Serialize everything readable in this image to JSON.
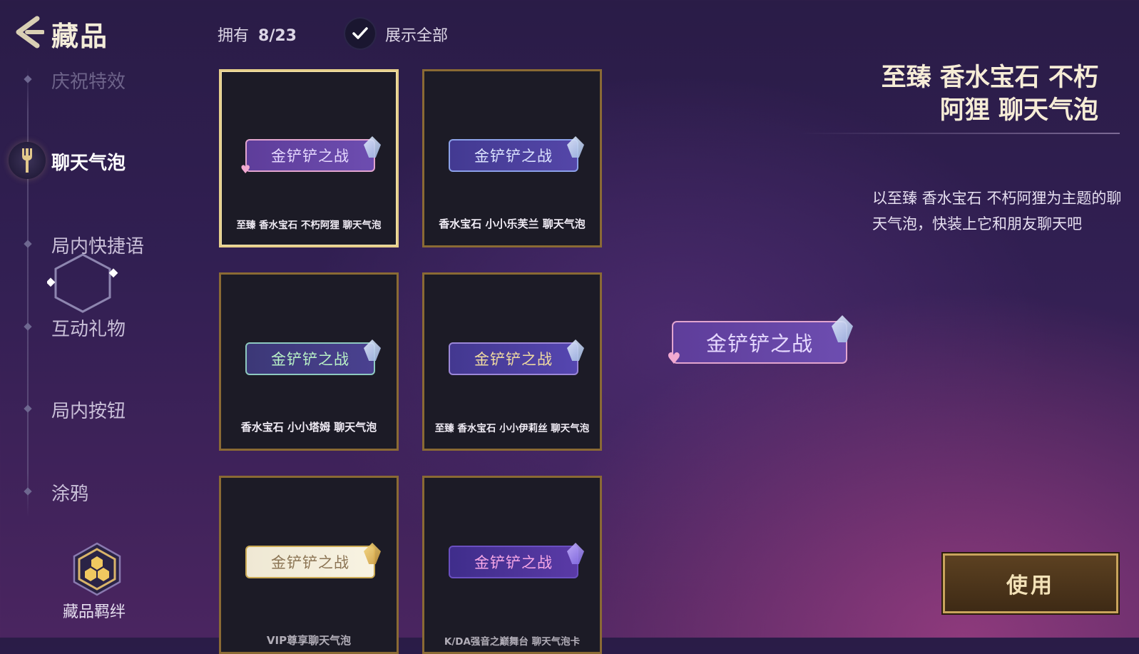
{
  "header": {
    "title": "藏品",
    "owned_label": "拥有",
    "owned_count": "8/23",
    "show_all_label": "展示全部",
    "show_all_checked": true
  },
  "nav": {
    "items": [
      {
        "label": "庆祝特效",
        "state": "faded"
      },
      {
        "label": "聊天气泡",
        "state": "active"
      },
      {
        "label": "局内快捷语",
        "state": "normal"
      },
      {
        "label": "互动礼物",
        "state": "normal"
      },
      {
        "label": "局内按钮",
        "state": "normal"
      },
      {
        "label": "涂鸦",
        "state": "normal"
      }
    ],
    "bond_label": "藏品羁绊"
  },
  "cards": [
    {
      "bubble_text": "金铲铲之战",
      "name": "至臻 香水宝石 不朽阿狸 聊天气泡",
      "style": "ahri",
      "selected": true
    },
    {
      "bubble_text": "金铲铲之战",
      "name": "香水宝石 小小乐芙兰 聊天气泡",
      "style": "lux",
      "selected": false
    },
    {
      "bubble_text": "金铲铲之战",
      "name": "香水宝石 小小塔姆 聊天气泡",
      "style": "kench",
      "selected": false
    },
    {
      "bubble_text": "金铲铲之战",
      "name": "至臻 香水宝石 小小伊莉丝 聊天气泡",
      "style": "zoe",
      "selected": false
    },
    {
      "bubble_text": "金铲铲之战",
      "name": "VIP尊享聊天气泡",
      "style": "vip",
      "selected": false
    },
    {
      "bubble_text": "金铲铲之战",
      "name": "K/DA强音之巅舞台 聊天气泡卡",
      "style": "kda",
      "selected": false
    }
  ],
  "detail": {
    "title_line1": "至臻 香水宝石 不朽",
    "title_line2": "阿狸 聊天气泡",
    "description": "以至臻 香水宝石 不朽阿狸为主题的聊天气泡，快装上它和朋友聊天吧",
    "preview_text": "金铲铲之战",
    "use_button": "使用"
  },
  "colors": {
    "gold_border": "#8a6a34",
    "selected_border": "#e6cf8a",
    "card_bg": "#1c1b26"
  }
}
